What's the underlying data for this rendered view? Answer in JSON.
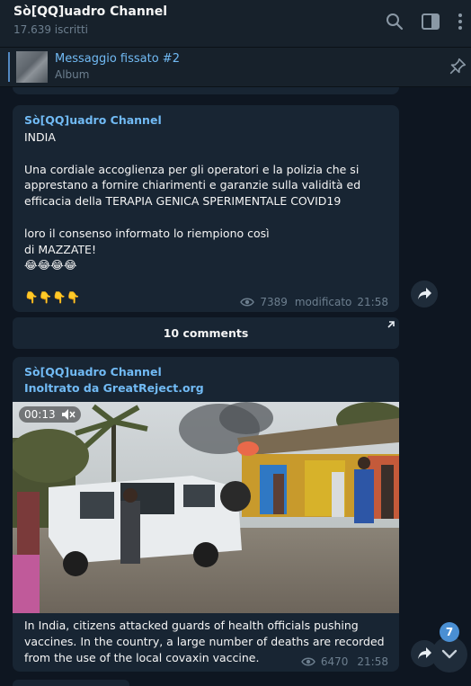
{
  "header": {
    "title": "Sò[QQ]uadro Channel",
    "subtitle": "17.639 iscritti"
  },
  "pinned": {
    "title": "Messaggio fissato #2",
    "subtitle": "Album"
  },
  "messages": [
    {
      "sender": "Sò[QQ]uadro Channel",
      "text": "INDIA\n\nUna cordiale accoglienza per gli operatori e la polizia che si apprestano a fornire chiarimenti e garanzie sulla validità ed efficacia della TERAPIA GENICA SPERIMENTALE COVID19\n\nloro il consenso informato lo riempiono così\ndi MAZZATE!\n😂😂😂😂\n\n👇👇👇👇",
      "views": "7389",
      "edited": "modificato",
      "time": "21:58"
    },
    {
      "sender": "Sò[QQ]uadro Channel",
      "forwarded": "Inoltrato da GreatReject.org",
      "video_duration": "00:13",
      "caption": "In India, citizens attacked guards of health officials pushing vaccines. In the country, a large number of deaths are recorded from the use of the local covaxin vaccine.",
      "views": "6470",
      "time": "21:58"
    }
  ],
  "comments": {
    "label": "10 comments"
  },
  "unread_badge": "7"
}
